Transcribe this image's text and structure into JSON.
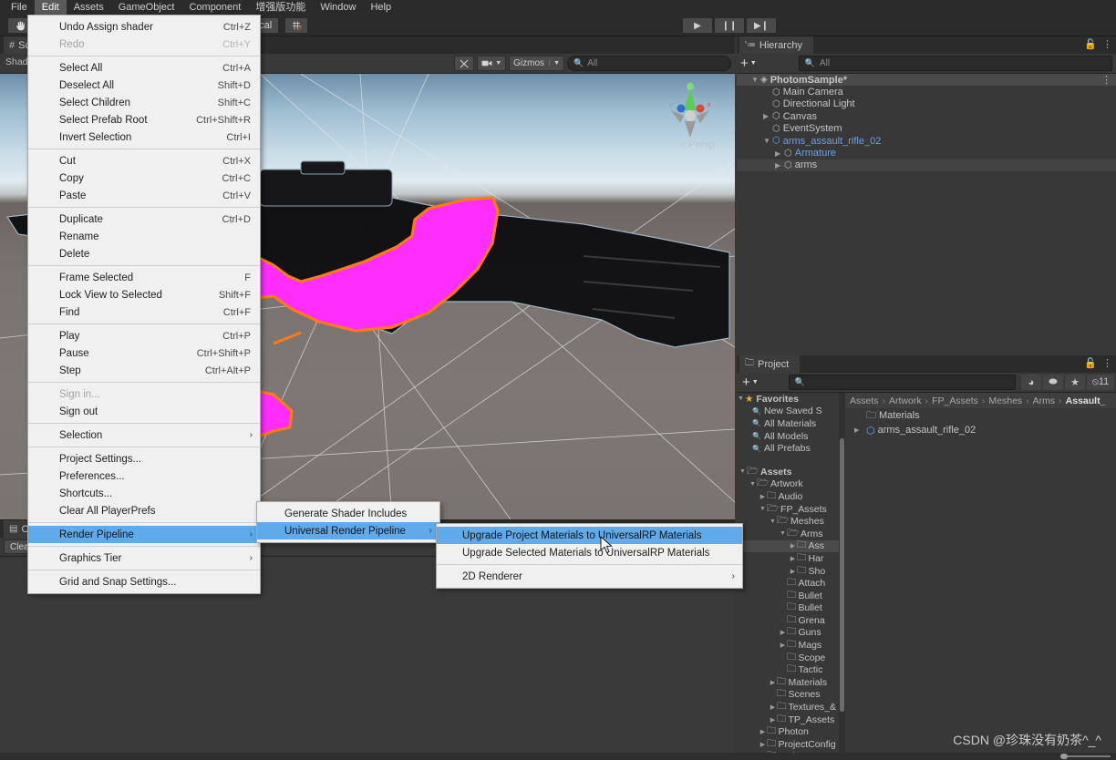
{
  "app": {
    "title": "Unity Editor"
  },
  "menubar": {
    "items": [
      {
        "label": "File",
        "active": false
      },
      {
        "label": "Edit",
        "active": true
      },
      {
        "label": "Assets",
        "active": false
      },
      {
        "label": "GameObject",
        "active": false
      },
      {
        "label": "Component",
        "active": false
      },
      {
        "label": "增强版功能",
        "active": false
      },
      {
        "label": "Window",
        "active": false
      },
      {
        "label": "Help",
        "active": false
      }
    ]
  },
  "toolbar": {
    "hand_tool_icon": "hand-icon",
    "pivot_mode_label": "Local",
    "grid_snap_icon": "grid-snap-icon",
    "play_label": "▶",
    "pause_label": "❙❙",
    "step_label": "▶❙"
  },
  "scene_view": {
    "tab_label": "Scene",
    "tab_icon": "scene-icon",
    "shading_label": "Shad",
    "tools_icon": "tools-icon",
    "camera_icon": "scene-camera-icon",
    "gizmos_label": "Gizmos",
    "search_placeholder": "All",
    "search_icon": "search-icon",
    "persp_label": "Persp",
    "gizmo_axes": [
      "x",
      "y",
      "z"
    ]
  },
  "console": {
    "tab_label": "Console",
    "tab_icon": "console-icon",
    "clear_label": "Clear"
  },
  "hierarchy": {
    "tab_label": "Hierarchy",
    "tab_icon": "hierarchy-icon",
    "lock_icon": "lock-icon",
    "menu_icon": "kebab-menu-icon",
    "add_label": "+",
    "search_placeholder": "All",
    "search_icon": "search-icon",
    "rows": [
      {
        "label": "PhotomSample*",
        "indent": 0,
        "tri": "▼",
        "icon": "scene-asset-icon",
        "state": "root",
        "blue": false
      },
      {
        "label": "Main Camera",
        "indent": 1,
        "tri": "",
        "icon": "gameobject-icon",
        "state": "",
        "blue": false
      },
      {
        "label": "Directional Light",
        "indent": 1,
        "tri": "",
        "icon": "gameobject-icon",
        "state": "",
        "blue": false
      },
      {
        "label": "Canvas",
        "indent": 1,
        "tri": "▶",
        "icon": "gameobject-icon",
        "state": "",
        "blue": false
      },
      {
        "label": "EventSystem",
        "indent": 1,
        "tri": "",
        "icon": "gameobject-icon",
        "state": "",
        "blue": false
      },
      {
        "label": "arms_assault_rifle_02",
        "indent": 1,
        "tri": "▼",
        "icon": "prefab-icon",
        "state": "",
        "blue": true
      },
      {
        "label": "Armature",
        "indent": 2,
        "tri": "▶",
        "icon": "gameobject-icon",
        "state": "",
        "blue": true
      },
      {
        "label": "arms",
        "indent": 2,
        "tri": "▶",
        "icon": "gameobject-icon",
        "state": "selected",
        "blue": false
      }
    ]
  },
  "project": {
    "tab_label": "Project",
    "tab_icon": "folder-icon",
    "lock_icon": "lock-icon",
    "menu_icon": "kebab-menu-icon",
    "add_label": "+",
    "search_placeholder": "",
    "search_icon": "search-icon",
    "filter_buttons": [
      {
        "name": "search-by-type-icon",
        "glyph": "◕"
      },
      {
        "name": "search-by-label-icon",
        "glyph": "⬬"
      },
      {
        "name": "favorites-star-icon",
        "glyph": "★"
      },
      {
        "name": "hidden-packages-icon",
        "glyph": "⦸11"
      }
    ],
    "favorites": {
      "label": "Favorites",
      "star_icon": "star-icon",
      "items": [
        {
          "label": "New Saved S",
          "icon": "search-icon"
        },
        {
          "label": "All Materials",
          "icon": "search-icon"
        },
        {
          "label": "All Models",
          "icon": "search-icon"
        },
        {
          "label": "All Prefabs",
          "icon": "search-icon"
        }
      ]
    },
    "tree": [
      {
        "label": "Assets",
        "indent": 0,
        "tri": "▼",
        "hl": false
      },
      {
        "label": "Artwork",
        "indent": 1,
        "tri": "▼",
        "hl": false
      },
      {
        "label": "Audio",
        "indent": 2,
        "tri": "▶",
        "hl": false
      },
      {
        "label": "FP_Assets",
        "indent": 2,
        "tri": "▼",
        "hl": false
      },
      {
        "label": "Meshes",
        "indent": 3,
        "tri": "▼",
        "hl": false
      },
      {
        "label": "Arms",
        "indent": 4,
        "tri": "▼",
        "hl": false
      },
      {
        "label": "Ass",
        "indent": 5,
        "tri": "▶",
        "hl": true
      },
      {
        "label": "Har",
        "indent": 5,
        "tri": "▶",
        "hl": false
      },
      {
        "label": "Sho",
        "indent": 5,
        "tri": "▶",
        "hl": false
      },
      {
        "label": "Attach",
        "indent": 4,
        "tri": "",
        "hl": false
      },
      {
        "label": "Bullet",
        "indent": 4,
        "tri": "",
        "hl": false
      },
      {
        "label": "Bullet",
        "indent": 4,
        "tri": "",
        "hl": false
      },
      {
        "label": "Grena",
        "indent": 4,
        "tri": "",
        "hl": false
      },
      {
        "label": "Guns",
        "indent": 4,
        "tri": "▶",
        "hl": false
      },
      {
        "label": "Mags",
        "indent": 4,
        "tri": "▶",
        "hl": false
      },
      {
        "label": "Scope",
        "indent": 4,
        "tri": "",
        "hl": false
      },
      {
        "label": "Tactic",
        "indent": 4,
        "tri": "",
        "hl": false
      },
      {
        "label": "Materials",
        "indent": 3,
        "tri": "▶",
        "hl": false
      },
      {
        "label": "Scenes",
        "indent": 3,
        "tri": "",
        "hl": false
      },
      {
        "label": "Textures_&",
        "indent": 3,
        "tri": "▶",
        "hl": false
      },
      {
        "label": "TP_Assets",
        "indent": 3,
        "tri": "▶",
        "hl": false
      },
      {
        "label": "Photon",
        "indent": 2,
        "tri": "▶",
        "hl": false
      },
      {
        "label": "ProjectConfig",
        "indent": 2,
        "tri": "▶",
        "hl": false
      },
      {
        "label": "Scripts",
        "indent": 2,
        "tri": "",
        "hl": false
      }
    ],
    "breadcrumb": [
      "Assets",
      "Artwork",
      "FP_Assets",
      "Meshes",
      "Arms",
      "Assault_"
    ],
    "contents": [
      {
        "label": "Materials",
        "icon": "folder-icon",
        "tri": ""
      },
      {
        "label": "arms_assault_rifle_02",
        "icon": "prefab-icon",
        "tri": "▶"
      }
    ]
  },
  "edit_menu": {
    "items": [
      {
        "label": "Undo Assign shader",
        "shortcut": "Ctrl+Z",
        "type": "item",
        "disabled": false
      },
      {
        "label": "Redo",
        "shortcut": "Ctrl+Y",
        "type": "item",
        "disabled": true
      },
      {
        "type": "sep"
      },
      {
        "label": "Select All",
        "shortcut": "Ctrl+A",
        "type": "item",
        "disabled": false
      },
      {
        "label": "Deselect All",
        "shortcut": "Shift+D",
        "type": "item",
        "disabled": false
      },
      {
        "label": "Select Children",
        "shortcut": "Shift+C",
        "type": "item",
        "disabled": false
      },
      {
        "label": "Select Prefab Root",
        "shortcut": "Ctrl+Shift+R",
        "type": "item",
        "disabled": false
      },
      {
        "label": "Invert Selection",
        "shortcut": "Ctrl+I",
        "type": "item",
        "disabled": false
      },
      {
        "type": "sep"
      },
      {
        "label": "Cut",
        "shortcut": "Ctrl+X",
        "type": "item",
        "disabled": false
      },
      {
        "label": "Copy",
        "shortcut": "Ctrl+C",
        "type": "item",
        "disabled": false
      },
      {
        "label": "Paste",
        "shortcut": "Ctrl+V",
        "type": "item",
        "disabled": false
      },
      {
        "type": "sep"
      },
      {
        "label": "Duplicate",
        "shortcut": "Ctrl+D",
        "type": "item",
        "disabled": false
      },
      {
        "label": "Rename",
        "shortcut": "",
        "type": "item",
        "disabled": false
      },
      {
        "label": "Delete",
        "shortcut": "",
        "type": "item",
        "disabled": false
      },
      {
        "type": "sep"
      },
      {
        "label": "Frame Selected",
        "shortcut": "F",
        "type": "item",
        "disabled": false
      },
      {
        "label": "Lock View to Selected",
        "shortcut": "Shift+F",
        "type": "item",
        "disabled": false
      },
      {
        "label": "Find",
        "shortcut": "Ctrl+F",
        "type": "item",
        "disabled": false
      },
      {
        "type": "sep"
      },
      {
        "label": "Play",
        "shortcut": "Ctrl+P",
        "type": "item",
        "disabled": false
      },
      {
        "label": "Pause",
        "shortcut": "Ctrl+Shift+P",
        "type": "item",
        "disabled": false
      },
      {
        "label": "Step",
        "shortcut": "Ctrl+Alt+P",
        "type": "item",
        "disabled": false
      },
      {
        "type": "sep"
      },
      {
        "label": "Sign in...",
        "shortcut": "",
        "type": "item",
        "disabled": true
      },
      {
        "label": "Sign out",
        "shortcut": "",
        "type": "item",
        "disabled": false
      },
      {
        "type": "sep"
      },
      {
        "label": "Selection",
        "shortcut": "",
        "type": "submenu",
        "disabled": false
      },
      {
        "type": "sep"
      },
      {
        "label": "Project Settings...",
        "shortcut": "",
        "type": "item",
        "disabled": false
      },
      {
        "label": "Preferences...",
        "shortcut": "",
        "type": "item",
        "disabled": false
      },
      {
        "label": "Shortcuts...",
        "shortcut": "",
        "type": "item",
        "disabled": false
      },
      {
        "label": "Clear All PlayerPrefs",
        "shortcut": "",
        "type": "item",
        "disabled": false
      },
      {
        "type": "sep"
      },
      {
        "label": "Render Pipeline",
        "shortcut": "",
        "type": "submenu",
        "disabled": false,
        "highlighted": true
      },
      {
        "type": "sep"
      },
      {
        "label": "Graphics Tier",
        "shortcut": "",
        "type": "submenu",
        "disabled": false
      },
      {
        "type": "sep"
      },
      {
        "label": "Grid and Snap Settings...",
        "shortcut": "",
        "type": "item",
        "disabled": false
      }
    ]
  },
  "render_pipeline_menu": {
    "items": [
      {
        "label": "Generate Shader Includes",
        "type": "item",
        "highlighted": false
      },
      {
        "label": "Universal Render Pipeline",
        "type": "submenu",
        "highlighted": true
      }
    ]
  },
  "urp_menu": {
    "items": [
      {
        "label": "Upgrade Project Materials to UniversalRP Materials",
        "type": "item",
        "highlighted": true
      },
      {
        "label": "Upgrade Selected Materials to UniversalRP Materials",
        "type": "item",
        "highlighted": false
      },
      {
        "type": "sep"
      },
      {
        "label": "2D Renderer",
        "type": "submenu",
        "highlighted": false
      }
    ]
  },
  "watermark": {
    "text": "CSDN @珍珠没有奶茶^_^"
  },
  "colors": {
    "menu_highlight": "#5eaaeb",
    "selection_outline": "#ff7a18",
    "missing_material": "#ff2dff",
    "panel_bg": "#383838",
    "toolbar_bg": "#2b2b2b"
  }
}
